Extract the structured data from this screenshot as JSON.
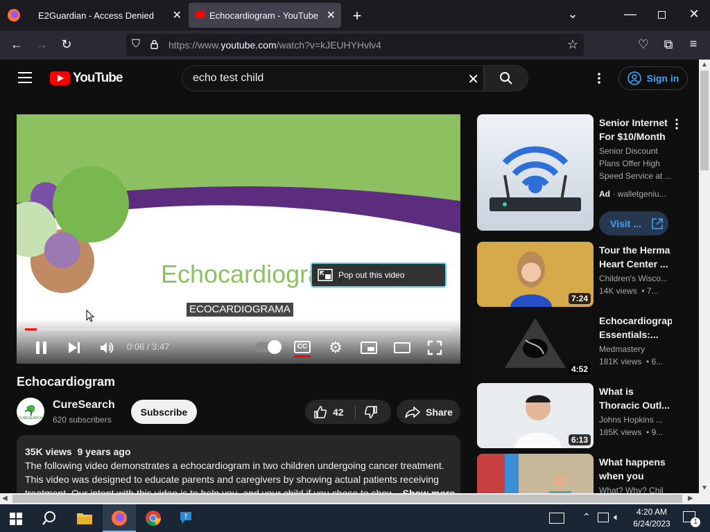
{
  "browser": {
    "tabs": [
      {
        "title": "E2Guardian - Access Denied"
      },
      {
        "title": "Echocardiogram - YouTube"
      }
    ],
    "url_prefix": "https://www.",
    "url_host": "youtube.com",
    "url_path": "/watch?v=kJEUHYHvlv4"
  },
  "youtube": {
    "logo_text": "YouTube",
    "search_query": "echo test child",
    "signin_label": "Sign in"
  },
  "player": {
    "slide_title": "Echocardiogram",
    "caption": "ECOCARDIOGRAMA",
    "popout_label": "Pop out this video",
    "time": "0:06 / 3:47",
    "progress": 0.027
  },
  "video": {
    "title": "Echocardiogram",
    "channel": "CureSearch",
    "avatar_text": "CURESEARCH",
    "subscribers": "620 subscribers",
    "subscribe_label": "Subscribe",
    "likes": "42",
    "share_label": "Share",
    "views_date": "35K views  9 years ago",
    "description": "The following video demonstrates a echocardiogram in two children undergoing cancer treatment. This video was designed to educate parents and caregivers by showing actual patients receiving treatment. Our intent with this video is to help you, and your child if you chose to show",
    "show_more": "...Show more"
  },
  "recommendations": [
    {
      "title": "Senior Internet For $10/Month",
      "line2": "Senior Discount Plans Offer High Speed Service at ...",
      "ad_label": "Ad",
      "ad_source": "walletgeniu...",
      "visit_label": "Visit ..."
    },
    {
      "title": "Tour the Herma Heart Center ...",
      "channel": "Children's Wisco...",
      "meta": "14K views  • 7...",
      "duration": "7:24"
    },
    {
      "title": "Echocardiograph Essentials:...",
      "channel": "Medmastery",
      "meta": "181K views  • 6...",
      "duration": "4:52"
    },
    {
      "title": "What is Thoracic Outl...",
      "channel": "Johns Hopkins ...",
      "meta": "185K views  • 9...",
      "duration": "6:13"
    },
    {
      "title": "What happens when you wea...",
      "channel": "What? Why? Chil",
      "meta": ""
    }
  ],
  "taskbar": {
    "time": "4:20 AM",
    "date": "6/24/2023",
    "notif_count": "1"
  },
  "colors": {
    "yt_red": "#ff0000",
    "link_blue": "#3ea6ff",
    "slide_green": "#8dc060",
    "slide_purple": "#5c2d7e"
  }
}
